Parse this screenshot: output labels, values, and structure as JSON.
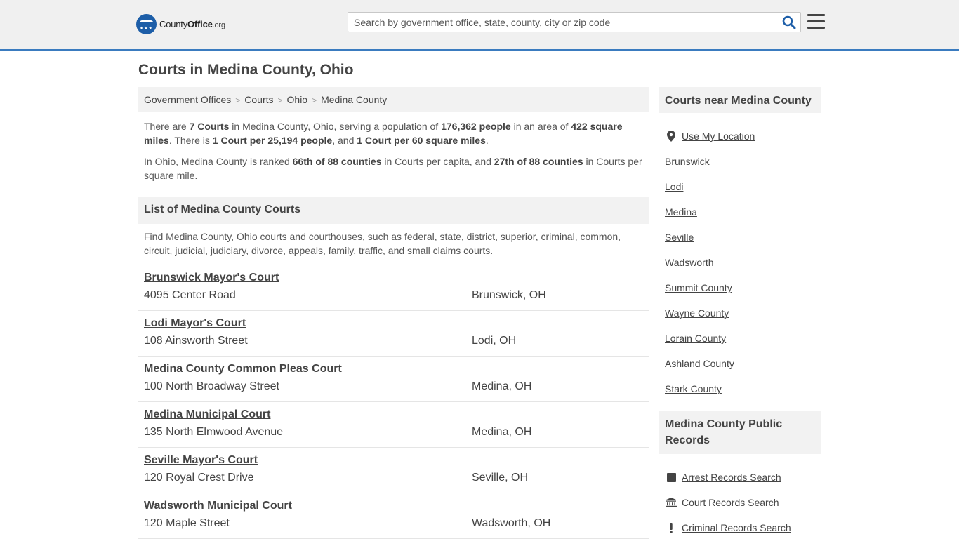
{
  "header": {
    "logo": {
      "word1": "County",
      "word2": "Office",
      "suffix": ".org"
    },
    "search": {
      "placeholder": "Search by government office, state, county, city or zip code"
    }
  },
  "page_title": "Courts in Medina County, Ohio",
  "breadcrumb": [
    "Government Offices",
    "Courts",
    "Ohio",
    "Medina County"
  ],
  "intro": {
    "p1": {
      "t1": "There are ",
      "b1": "7 Courts",
      "t2": " in Medina County, Ohio, serving a population of ",
      "b2": "176,362 people",
      "t3": " in an area of ",
      "b3": "422 square miles",
      "t4": ". There is ",
      "b4": "1 Court per 25,194 people",
      "t5": ", and ",
      "b5": "1 Court per 60 square miles",
      "t6": "."
    },
    "p2": {
      "t1": "In Ohio, Medina County is ranked ",
      "b1": "66th of 88 counties",
      "t2": " in Courts per capita, and ",
      "b2": "27th of 88 counties",
      "t3": " in Courts per square mile."
    }
  },
  "list": {
    "heading": "List of Medina County Courts",
    "description": "Find Medina County, Ohio courts and courthouses, such as federal, state, district, superior, criminal, common, circuit, judicial, judiciary, divorce, appeals, family, traffic, and small claims courts.",
    "courts": [
      {
        "name": "Brunswick Mayor's Court",
        "address": "4095 Center Road",
        "city": "Brunswick, OH"
      },
      {
        "name": "Lodi Mayor's Court",
        "address": "108 Ainsworth Street",
        "city": "Lodi, OH"
      },
      {
        "name": "Medina County Common Pleas Court",
        "address": "100 North Broadway Street",
        "city": "Medina, OH"
      },
      {
        "name": "Medina Municipal Court",
        "address": "135 North Elmwood Avenue",
        "city": "Medina, OH"
      },
      {
        "name": "Seville Mayor's Court",
        "address": "120 Royal Crest Drive",
        "city": "Seville, OH"
      },
      {
        "name": "Wadsworth Municipal Court",
        "address": "120 Maple Street",
        "city": "Wadsworth, OH"
      }
    ]
  },
  "sidebar": {
    "nearby_heading": "Courts near Medina County",
    "use_location": "Use My Location",
    "nearby": [
      "Brunswick",
      "Lodi",
      "Medina",
      "Seville",
      "Wadsworth",
      "Summit County",
      "Wayne County",
      "Lorain County",
      "Ashland County",
      "Stark County"
    ],
    "records_heading": "Medina County Public Records",
    "records": [
      {
        "label": "Arrest Records Search",
        "icon": "square-icon"
      },
      {
        "label": "Court Records Search",
        "icon": "courthouse-icon"
      },
      {
        "label": "Criminal Records Search",
        "icon": "exclamation-icon"
      }
    ]
  },
  "colors": {
    "accent": "#3a7bbf",
    "logo": "#1d5ea8",
    "search_icon": "#1d5ea8"
  }
}
